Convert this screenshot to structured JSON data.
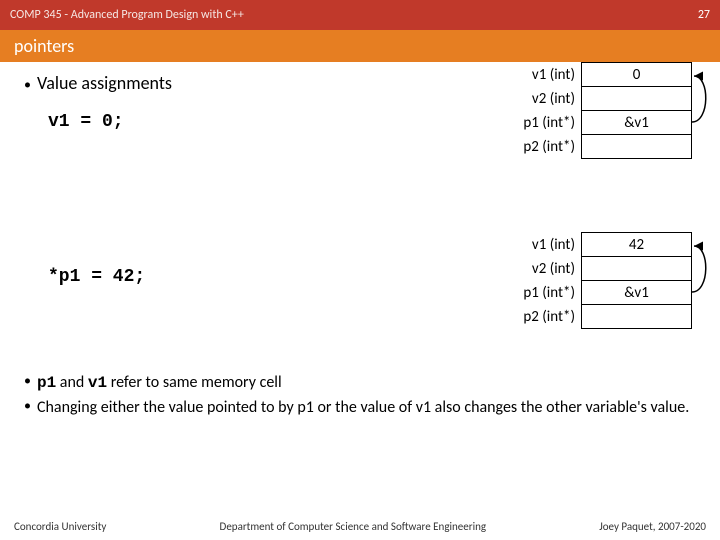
{
  "header": {
    "course": "COMP 345 - Advanced Program Design with C++",
    "page": "27"
  },
  "subheader": {
    "title": "pointers"
  },
  "heading": "Value assignments",
  "code1": "v1 = 0;",
  "code2": "*p1 = 42;",
  "diagram1": {
    "rows": [
      "v1 (int)",
      "v2 (int)",
      "p1 (int*)",
      "p2 (int*)"
    ],
    "vals": [
      "0",
      "",
      "&v1",
      ""
    ]
  },
  "diagram2": {
    "rows": [
      "v1 (int)",
      "v2 (int)",
      "p1 (int*)",
      "p2 (int*)"
    ],
    "vals": [
      "42",
      "",
      "&v1",
      ""
    ]
  },
  "notes": {
    "n1a": "p1",
    "n1b": " and ",
    "n1c": "v1",
    "n1d": " refer to same memory cell",
    "n2": "Changing either the value pointed to by p1 or the value of v1 also changes the other variable's value."
  },
  "footer": {
    "left": "Concordia University",
    "center": "Department of Computer Science and Software Engineering",
    "right": "Joey Paquet, 2007-2020"
  }
}
